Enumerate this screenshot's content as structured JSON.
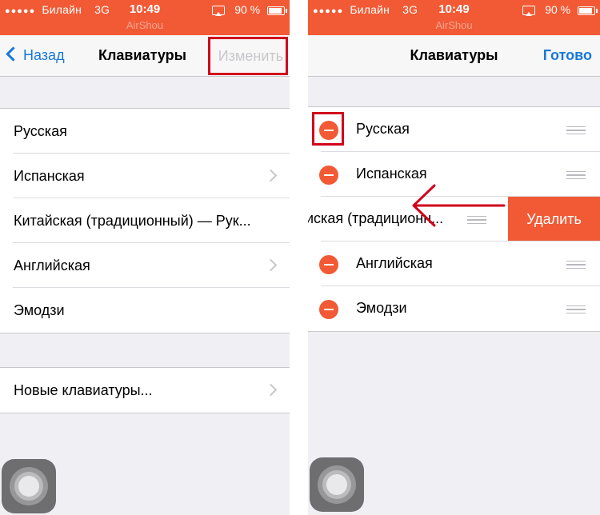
{
  "left_screen": {
    "status_bar": {
      "dots": "●●●●●",
      "carrier": "Билайн",
      "network": "3G",
      "time": "10:49",
      "battery": "90 %",
      "battery_level": 0.9
    },
    "watermark": "AirShou",
    "nav": {
      "back_label": "Назад",
      "title": "Клавиатуры",
      "edit_label": "Изменить"
    },
    "keyboards": [
      {
        "label": "Русская",
        "chevron": false
      },
      {
        "label": "Испанская",
        "chevron": true
      },
      {
        "label": "Китайская (традиционный) — Рук...",
        "chevron": false
      },
      {
        "label": "Английская",
        "chevron": true
      },
      {
        "label": "Эмодзи",
        "chevron": false
      }
    ],
    "new_keyboard_label": "Новые клавиатуры..."
  },
  "right_screen": {
    "status_bar": {
      "dots": "●●●●●",
      "carrier": "Билайн",
      "network": "3G",
      "time": "10:49",
      "battery": "90 %",
      "battery_level": 0.9
    },
    "watermark": "AirShou",
    "nav": {
      "title": "Клавиатуры",
      "done_label": "Готово"
    },
    "keyboards": [
      {
        "label": "Русская"
      },
      {
        "label": "Испанская"
      },
      {
        "label": "иская (традиционн...",
        "swiped": true
      },
      {
        "label": "Английская"
      },
      {
        "label": "Эмодзи"
      }
    ],
    "delete_label": "Удалить"
  },
  "icons": {
    "delete_control": "minus-circle-icon",
    "reorder": "reorder-grip-icon",
    "assistive_touch": "assistive-touch-icon"
  },
  "colors": {
    "accent": "#f15a35",
    "link": "#1778d9",
    "highlight": "#d0021b"
  }
}
